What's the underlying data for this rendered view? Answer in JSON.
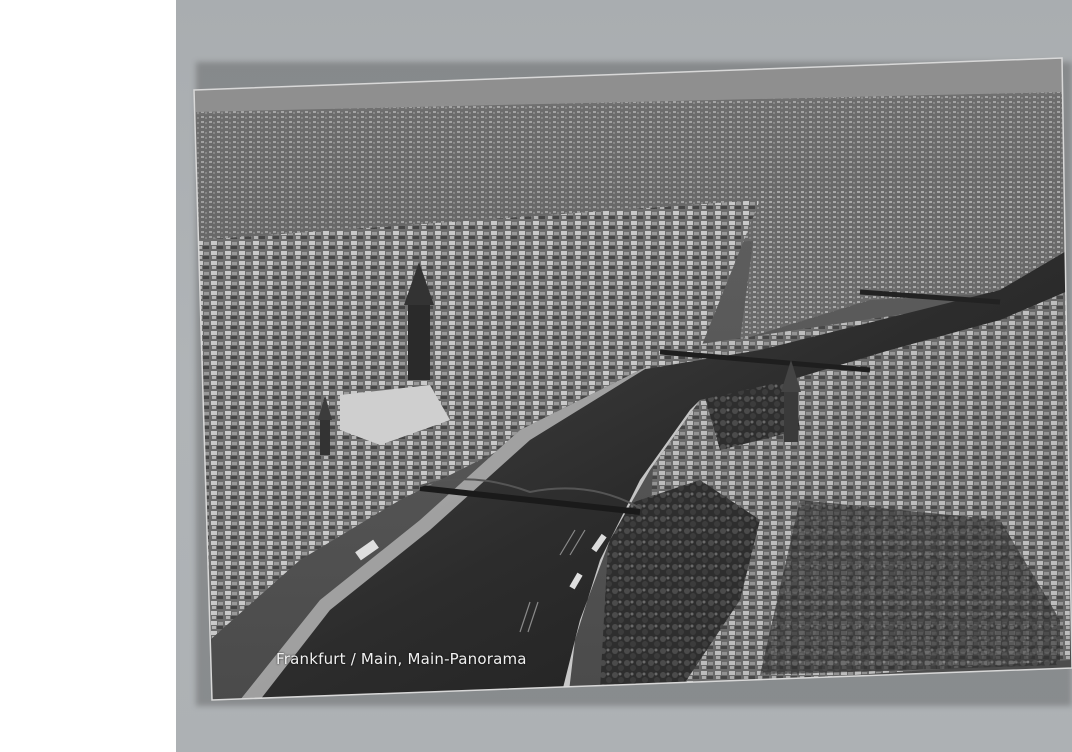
{
  "postcard": {
    "caption": "Frankfurt / Main, Main-Panorama"
  },
  "palette": {
    "background": "#aeb2b5",
    "margin": "#ffffff",
    "river": "#2a2a2a",
    "city_light": "#cfcfcf",
    "city_dark": "#3a3a3a",
    "sky_haze": "#8a8a8a"
  }
}
